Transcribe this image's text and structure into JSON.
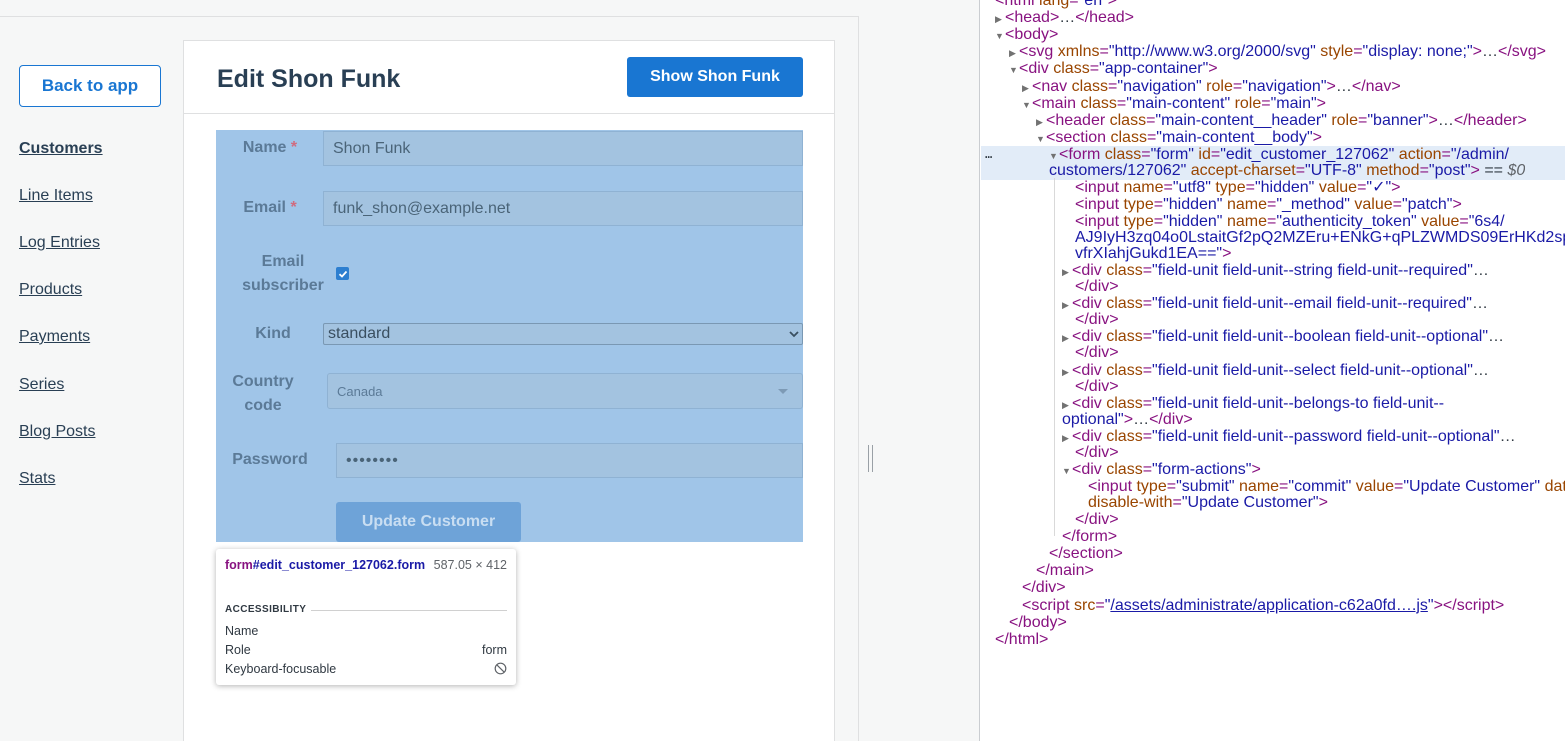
{
  "app": {
    "back_label": "Back to app",
    "nav": [
      {
        "label": "Customers",
        "active": true
      },
      {
        "label": "Line Items"
      },
      {
        "label": "Log Entries"
      },
      {
        "label": "Products"
      },
      {
        "label": "Payments"
      },
      {
        "label": "Series"
      },
      {
        "label": "Blog Posts"
      },
      {
        "label": "Stats"
      }
    ],
    "page_title": "Edit Shon Funk",
    "show_label": "Show Shon Funk",
    "form": {
      "name_label": "Name",
      "name_value": "Shon Funk",
      "email_label": "Email",
      "email_value": "funk_shon@example.net",
      "required_mark": "*",
      "subscriber_label_1": "Email",
      "subscriber_label_2": "subscriber",
      "subscriber_checked": true,
      "kind_label": "Kind",
      "kind_value": "standard",
      "country_label_1": "Country",
      "country_label_2": "code",
      "country_value": "Canada",
      "password_label": "Password",
      "password_value": "••••••••",
      "submit_label": "Update Customer"
    }
  },
  "inspector": {
    "selector_tag": "form",
    "selector_rest": "#edit_customer_127062.form",
    "size": "587.05 × 412",
    "section": "ACCESSIBILITY",
    "rows": [
      {
        "key": "Name",
        "value": ""
      },
      {
        "key": "Role",
        "value": "form"
      },
      {
        "key": "Keyboard-focusable",
        "value": "⃠"
      }
    ]
  },
  "devtools": {
    "selected_marker": "== $0",
    "dots": "…"
  }
}
